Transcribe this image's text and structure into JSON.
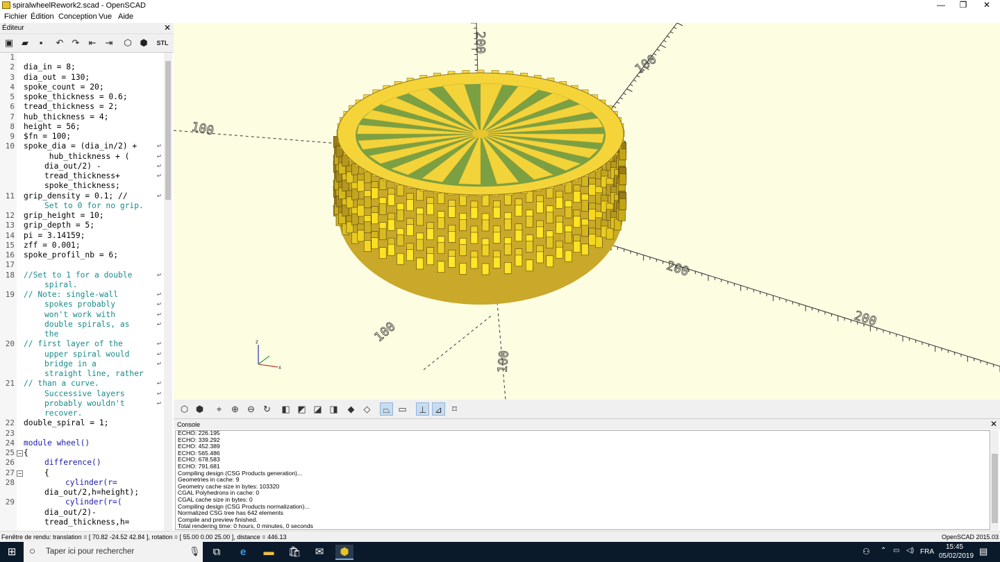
{
  "window": {
    "title": "spiralwheelRework2.scad - OpenSCAD",
    "controls": [
      "—",
      "❐",
      "✕"
    ]
  },
  "menu": [
    "Fichier",
    "Édition",
    "Conception",
    "Vue",
    "Aide"
  ],
  "editor": {
    "title": "Éditeur",
    "close": "✕",
    "toolbar_icons": [
      "new-icon",
      "open-icon",
      "save-icon",
      "undo-icon",
      "redo-icon",
      "unindent-icon",
      "indent-icon",
      "preview-icon",
      "render-icon",
      "stl-export-icon"
    ],
    "stl_label": "STL",
    "lines": [
      {
        "n": "1",
        "text": ""
      },
      {
        "n": "2",
        "text": "dia_in = 8;"
      },
      {
        "n": "3",
        "text": "dia_out = 130;"
      },
      {
        "n": "4",
        "text": "spoke_count = 20;"
      },
      {
        "n": "5",
        "text": "spoke_thickness = 0.6;"
      },
      {
        "n": "6",
        "text": "tread_thickness = 2;"
      },
      {
        "n": "7",
        "text": "hub_thickness = 4;"
      },
      {
        "n": "8",
        "text": "height = 56;"
      },
      {
        "n": "9",
        "text": "$fn = 100;"
      },
      {
        "n": "10",
        "text": "spoke_dia = (dia_in/2) +",
        "wrap": true
      },
      {
        "n": "",
        "text": " hub_thickness + (",
        "indent": 1,
        "wrap": true
      },
      {
        "n": "",
        "text": "dia_out/2) -",
        "indent": 1,
        "wrap": true
      },
      {
        "n": "",
        "text": "tread_thickness+",
        "indent": 1,
        "wrap": true
      },
      {
        "n": "",
        "text": "spoke_thickness;",
        "indent": 1
      },
      {
        "n": "11",
        "text": "grip_density = 0.1; //",
        "wrap": true
      },
      {
        "n": "",
        "text": "Set to 0 for no grip.",
        "indent": 1,
        "comment": true
      },
      {
        "n": "12",
        "text": "grip_height = 10;"
      },
      {
        "n": "13",
        "text": "grip_depth = 5;"
      },
      {
        "n": "14",
        "text": "pi = 3.14159;"
      },
      {
        "n": "15",
        "text": "zff = 0.001;"
      },
      {
        "n": "16",
        "text": "spoke_profil_nb = 6;"
      },
      {
        "n": "17",
        "text": ""
      },
      {
        "n": "18",
        "text": "//Set to 1 for a double",
        "comment": true,
        "wrap": true
      },
      {
        "n": "",
        "text": "spiral.",
        "indent": 1,
        "comment": true
      },
      {
        "n": "19",
        "text": "// Note: single-wall",
        "comment": true,
        "wrap": true
      },
      {
        "n": "",
        "text": "spokes probably",
        "indent": 1,
        "comment": true,
        "wrap": true
      },
      {
        "n": "",
        "text": "won't work with",
        "indent": 1,
        "comment": true,
        "wrap": true
      },
      {
        "n": "",
        "text": "double spirals, as",
        "indent": 1,
        "comment": true,
        "wrap": true
      },
      {
        "n": "",
        "text": "the",
        "indent": 1,
        "comment": true
      },
      {
        "n": "20",
        "text": "// first layer of the",
        "comment": true,
        "wrap": true
      },
      {
        "n": "",
        "text": "upper spiral would",
        "indent": 1,
        "comment": true,
        "wrap": true
      },
      {
        "n": "",
        "text": "bridge in a",
        "indent": 1,
        "comment": true,
        "wrap": true
      },
      {
        "n": "",
        "text": "straight line, rather",
        "indent": 1,
        "comment": true
      },
      {
        "n": "21",
        "text": "// than a curve.",
        "comment": true,
        "wrap": true
      },
      {
        "n": "",
        "text": "Successive layers",
        "indent": 1,
        "comment": true,
        "wrap": true
      },
      {
        "n": "",
        "text": "probably wouldn't",
        "indent": 1,
        "comment": true,
        "wrap": true
      },
      {
        "n": "",
        "text": "recover.",
        "indent": 1,
        "comment": true
      },
      {
        "n": "22",
        "text": "double_spiral = 1;"
      },
      {
        "n": "23",
        "text": ""
      },
      {
        "n": "24",
        "text": "module wheel()",
        "keyword": true
      },
      {
        "n": "25",
        "text": "{",
        "fold": true
      },
      {
        "n": "26",
        "text": "difference()",
        "indent": 1,
        "keyword": true
      },
      {
        "n": "27",
        "text": "{",
        "indent": 1,
        "fold": true
      },
      {
        "n": "28",
        "text": "cylinder(r=",
        "indent": 2,
        "keyword": true
      },
      {
        "n": "",
        "text": "dia_out/2,h=height);",
        "indent": 1
      },
      {
        "n": "29",
        "text": "cylinder(r=(",
        "indent": 2,
        "keyword": true
      },
      {
        "n": "",
        "text": "dia_out/2)-",
        "indent": 1
      },
      {
        "n": "",
        "text": "tread_thickness,h=",
        "indent": 1
      }
    ]
  },
  "viewport": {
    "axis_labels": [
      "200",
      "100",
      "100",
      "200",
      "200",
      "100",
      "100"
    ],
    "gizmo": {
      "x": "x",
      "z": "z"
    }
  },
  "view_toolbar": [
    "preview-icon",
    "render-icon",
    "view-all-icon",
    "zoom-in-icon",
    "zoom-out-icon",
    "reset-view-icon",
    "view-right-icon",
    "view-top-icon",
    "view-bottom-icon",
    "view-left-icon",
    "view-front-icon",
    "view-back-icon",
    "perspective-icon",
    "orthogonal-icon",
    "show-axes-icon",
    "show-scale-icon",
    "show-edges-icon"
  ],
  "console": {
    "title": "Console",
    "close": "✕",
    "lines": [
      "ECHO: 226.195",
      "ECHO: 339.292",
      "ECHO: 452.389",
      "ECHO: 565.486",
      "ECHO: 678.583",
      "ECHO: 791.681",
      "Compiling design (CSG Products generation)...",
      "Geometries in cache: 9",
      "Geometry cache size in bytes: 103320",
      "CGAL Polyhedrons in cache: 0",
      "CGAL cache size in bytes: 0",
      "Compiling design (CSG Products normalization)...",
      "Normalized CSG tree has 642 elements",
      "Compile and preview finished.",
      "Total rendering time: 0 hours, 0 minutes, 0 seconds"
    ]
  },
  "status": {
    "left": "Fenêtre de rendu: translation = [ 70.82 -24.52 42.84 ], rotation = [ 55.00 0.00 25.00 ], distance = 446.13",
    "right": "OpenSCAD 2015.03"
  },
  "taskbar": {
    "search_placeholder": "Taper ici pour rechercher",
    "lang": "FRA",
    "time": "15:45",
    "date": "05/02/2019"
  },
  "colors": {
    "viewport_bg": "#fdfde2",
    "model_yellow": "#f5d43a",
    "model_dark": "#4a3c08",
    "spokes_green": "#9bb84a"
  }
}
